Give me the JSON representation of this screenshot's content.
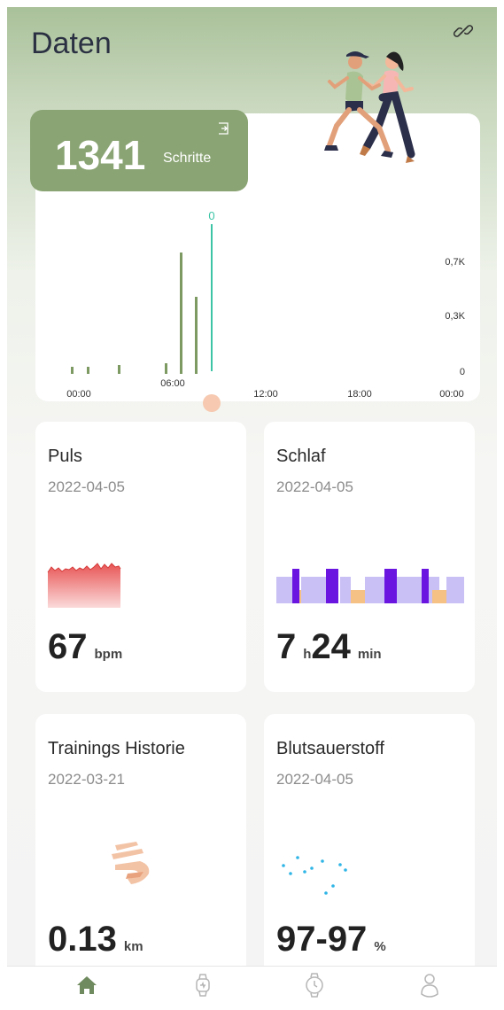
{
  "header": {
    "title": "Daten"
  },
  "steps": {
    "value": "1341",
    "unit": "Schritte",
    "chart": {
      "selected_label": "0",
      "y_ticks": [
        "0,7K",
        "0,3K",
        "0"
      ],
      "x_ticks": [
        "00:00",
        "06:00",
        "12:00",
        "18:00",
        "00:00"
      ]
    }
  },
  "cards": {
    "pulse": {
      "title": "Puls",
      "date": "2022-04-05",
      "value": "67",
      "unit": "bpm"
    },
    "sleep": {
      "title": "Schlaf",
      "date": "2022-04-05",
      "hours": "7",
      "hours_unit": "h",
      "minutes": "24",
      "minutes_unit": "min"
    },
    "training": {
      "title": "Trainings Historie",
      "date": "2022-03-21",
      "value": "0.13",
      "unit": "km"
    },
    "oxygen": {
      "title": "Blutsauerstoff",
      "date": "2022-04-05",
      "value": "97-97",
      "unit": "%"
    }
  },
  "nav": {
    "items": [
      {
        "icon": "home-icon",
        "active": true
      },
      {
        "icon": "watch-icon",
        "active": false
      },
      {
        "icon": "clock-icon",
        "active": false
      },
      {
        "icon": "profile-icon",
        "active": false
      }
    ]
  },
  "colors": {
    "accent": "#8aa473",
    "nav_active": "#6f8a5e",
    "pulse": "#e85555",
    "sleep_deep": "#6a16e0",
    "sleep_light": "#c9c0f5",
    "sleep_awake": "#f5c184",
    "oxygen": "#2fb5e6",
    "selected_line": "#3cc4a5"
  }
}
